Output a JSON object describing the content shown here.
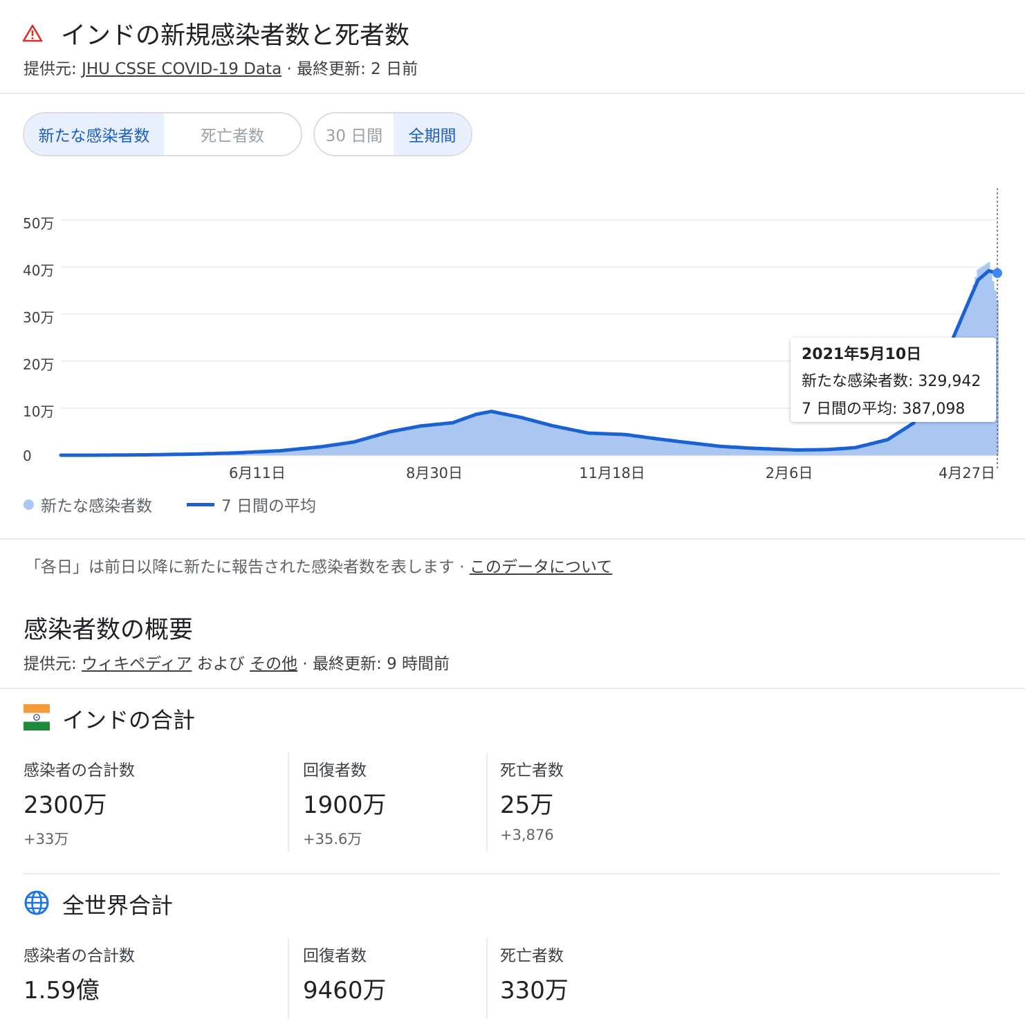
{
  "header": {
    "title": "インドの新規感染者数と死者数",
    "source_prefix": "提供元: ",
    "source_link": "JHU CSSE COVID-19 Data",
    "updated": " · 最終更新: 2 日前"
  },
  "toggles": {
    "metric": [
      "新たな感染者数",
      "死亡者数"
    ],
    "metric_selected": 0,
    "range": [
      "30 日間",
      "全期間"
    ],
    "range_selected": 1
  },
  "colors": {
    "bar": "#aac6f3",
    "line": "#1a62d2",
    "accent": "#1a5fc0"
  },
  "chart_data": {
    "type": "bar",
    "x_start": "2020-03-01",
    "x_end": "2021-05-10",
    "xtick_labels": [
      "6月11日",
      "8月30日",
      "11月18日",
      "2月6日",
      "4月27日"
    ],
    "xtick_dates": [
      "2020-06-11",
      "2020-08-30",
      "2020-11-18",
      "2021-02-06",
      "2021-04-27"
    ],
    "ytick_labels": [
      "0",
      "10万",
      "20万",
      "30万",
      "40万",
      "50万"
    ],
    "ytick_values": [
      0,
      100000,
      200000,
      300000,
      400000,
      500000
    ],
    "ylim": [
      0,
      500000
    ],
    "series": [
      {
        "name": "新たな感染者数",
        "kind": "bar",
        "x": [
          "2020-03-01",
          "2020-03-20",
          "2020-04-10",
          "2020-05-01",
          "2020-05-20",
          "2020-06-11",
          "2020-06-30",
          "2020-07-15",
          "2020-08-01",
          "2020-08-15",
          "2020-08-30",
          "2020-09-10",
          "2020-09-17",
          "2020-10-01",
          "2020-10-15",
          "2020-11-01",
          "2020-11-18",
          "2020-12-01",
          "2020-12-15",
          "2021-01-01",
          "2021-01-15",
          "2021-02-06",
          "2021-02-20",
          "2021-03-05",
          "2021-03-20",
          "2021-04-01",
          "2021-04-10",
          "2021-04-15",
          "2021-04-20",
          "2021-04-27",
          "2021-05-01",
          "2021-05-06",
          "2021-05-10"
        ],
        "values": [
          0,
          100,
          900,
          2500,
          5000,
          10000,
          19000,
          29000,
          52000,
          63000,
          70000,
          88000,
          97000,
          82000,
          64000,
          46000,
          45000,
          36000,
          27000,
          19000,
          15000,
          11000,
          13000,
          17000,
          35000,
          72000,
          145000,
          200000,
          260000,
          330000,
          395000,
          410000,
          329942
        ]
      },
      {
        "name": "7 日間の平均",
        "kind": "line",
        "x": [
          "2020-03-01",
          "2020-03-20",
          "2020-04-10",
          "2020-05-01",
          "2020-05-20",
          "2020-06-11",
          "2020-06-30",
          "2020-07-15",
          "2020-08-01",
          "2020-08-15",
          "2020-08-30",
          "2020-09-10",
          "2020-09-17",
          "2020-10-01",
          "2020-10-15",
          "2020-11-01",
          "2020-11-18",
          "2020-12-01",
          "2020-12-15",
          "2021-01-01",
          "2021-01-15",
          "2021-02-06",
          "2021-02-20",
          "2021-03-05",
          "2021-03-20",
          "2021-04-01",
          "2021-04-10",
          "2021-04-15",
          "2021-04-20",
          "2021-04-27",
          "2021-05-01",
          "2021-05-06",
          "2021-05-10"
        ],
        "values": [
          0,
          80,
          800,
          2300,
          4700,
          9500,
          18000,
          28000,
          50000,
          62000,
          69000,
          87000,
          93000,
          80000,
          63000,
          47000,
          44000,
          36000,
          28000,
          19000,
          15000,
          11000,
          12000,
          16000,
          33000,
          68000,
          140000,
          198000,
          255000,
          330000,
          372000,
          392000,
          387098
        ]
      }
    ],
    "tooltip": {
      "date": "2021年5月10日",
      "row1": "新たな感染者数: 329,942",
      "row2": "7 日間の平均: 387,098"
    },
    "legend": [
      "新たな感染者数",
      "7 日間の平均"
    ],
    "legend_position": "bottom-left"
  },
  "note": {
    "text": "「各日」は前日以降に新たに報告された感染者数を表します · ",
    "link": "このデータについて"
  },
  "overview": {
    "title": "感染者数の概要",
    "source_prefix": "提供元: ",
    "source_link1": "ウィキペディア",
    "source_mid": " および ",
    "source_link2": "その他",
    "updated": " · 最終更新: 9 時間前"
  },
  "india": {
    "title": "インドの合計",
    "flag_icon": "india-flag-icon",
    "stats": [
      {
        "label": "感染者の合計数",
        "value": "2300万",
        "delta": "+33万"
      },
      {
        "label": "回復者数",
        "value": "1900万",
        "delta": "+35.6万"
      },
      {
        "label": "死亡者数",
        "value": "25万",
        "delta": "+3,876"
      }
    ]
  },
  "world": {
    "title": "全世界合計",
    "globe_icon": "globe-icon",
    "stats": [
      {
        "label": "感染者の合計数",
        "value": "1.59億"
      },
      {
        "label": "回復者数",
        "value": "9460万"
      },
      {
        "label": "死亡者数",
        "value": "330万"
      }
    ]
  }
}
